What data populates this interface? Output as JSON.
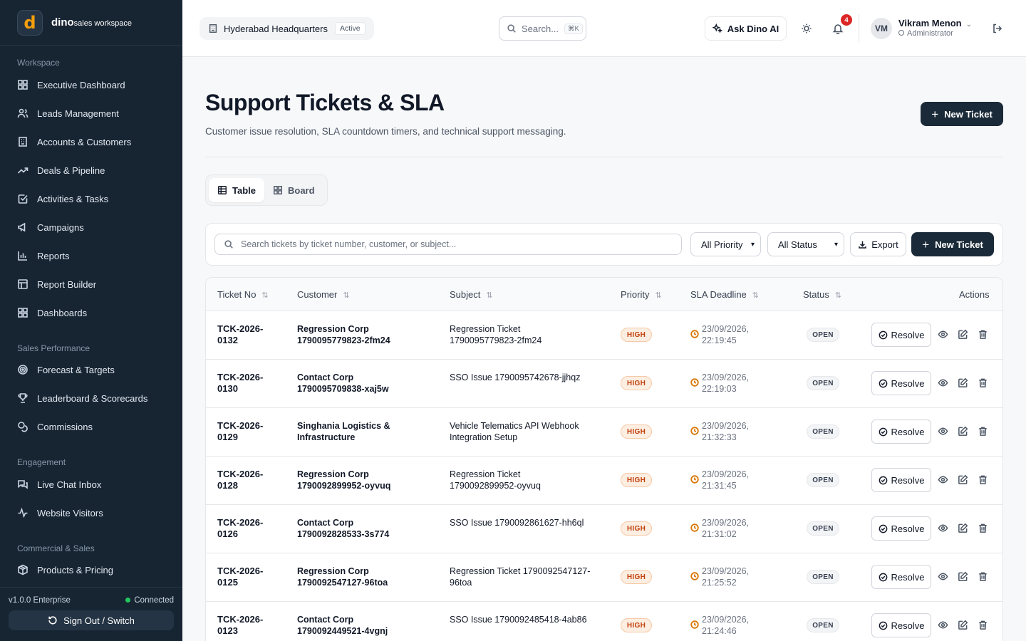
{
  "brand": {
    "logo_letter": "d",
    "name": "dino",
    "subtitle": "sales workspace"
  },
  "sidebar": {
    "sections": [
      {
        "title": "Workspace",
        "items": [
          {
            "label": "Executive Dashboard",
            "icon": "grid-icon"
          },
          {
            "label": "Leads Management",
            "icon": "users-icon"
          },
          {
            "label": "Accounts & Customers",
            "icon": "building-icon"
          },
          {
            "label": "Deals & Pipeline",
            "icon": "trend-icon"
          },
          {
            "label": "Activities & Tasks",
            "icon": "check-square-icon"
          },
          {
            "label": "Campaigns",
            "icon": "megaphone-icon"
          },
          {
            "label": "Reports",
            "icon": "bar-chart-icon"
          },
          {
            "label": "Report Builder",
            "icon": "table-icon"
          },
          {
            "label": "Dashboards",
            "icon": "grid-icon"
          }
        ]
      },
      {
        "title": "Sales Performance",
        "items": [
          {
            "label": "Forecast & Targets",
            "icon": "target-icon"
          },
          {
            "label": "Leaderboard & Scorecards",
            "icon": "trophy-icon"
          },
          {
            "label": "Commissions",
            "icon": "coins-icon"
          }
        ]
      },
      {
        "title": "Engagement",
        "items": [
          {
            "label": "Live Chat Inbox",
            "icon": "chat-icon"
          },
          {
            "label": "Website Visitors",
            "icon": "activity-icon"
          }
        ]
      },
      {
        "title": "Commercial & Sales",
        "items": [
          {
            "label": "Products & Pricing",
            "icon": "package-icon"
          }
        ]
      }
    ],
    "footer": {
      "version": "v1.0.0 Enterprise",
      "connection": "Connected",
      "signout_label": "Sign Out / Switch"
    }
  },
  "topbar": {
    "org_name": "Hyderabad Headquarters",
    "org_status": "Active",
    "search_placeholder": "Search...",
    "search_shortcut": "⌘K",
    "ask_ai_label": "Ask Dino AI",
    "notification_count": "4",
    "user": {
      "initials": "VM",
      "name": "Vikram Menon",
      "role": "Administrator"
    }
  },
  "page": {
    "title": "Support Tickets & SLA",
    "subtitle": "Customer issue resolution, SLA countdown timers, and technical support messaging.",
    "new_ticket_label": "New Ticket",
    "view_tabs": [
      {
        "label": "Table",
        "active": true
      },
      {
        "label": "Board",
        "active": false
      }
    ]
  },
  "filters": {
    "search_placeholder": "Search tickets by ticket number, customer, or subject...",
    "priority_selected": "All Priority",
    "status_selected": "All Status",
    "export_label": "Export",
    "new_ticket_label": "New Ticket"
  },
  "table": {
    "columns": {
      "ticket_no": "Ticket No",
      "customer": "Customer",
      "subject": "Subject",
      "priority": "Priority",
      "sla": "SLA Deadline",
      "status": "Status",
      "actions": "Actions"
    },
    "resolve_label": "Resolve",
    "rows": [
      {
        "ticket_a": "TCK-2026-",
        "ticket_b": "0132",
        "customer_a": "Regression Corp",
        "customer_b": "1790095779823-2fm24",
        "subject_a": "Regression Ticket",
        "subject_b": "1790095779823-2fm24",
        "priority": "HIGH",
        "sla_date": "23/09/2026,",
        "sla_time": "22:19:45",
        "status": "OPEN"
      },
      {
        "ticket_a": "TCK-2026-",
        "ticket_b": "0130",
        "customer_a": "Contact Corp",
        "customer_b": "1790095709838-xaj5w",
        "subject_a": "SSO Issue 1790095742678-jjhqz",
        "subject_b": "",
        "priority": "HIGH",
        "sla_date": "23/09/2026,",
        "sla_time": "22:19:03",
        "status": "OPEN"
      },
      {
        "ticket_a": "TCK-2026-",
        "ticket_b": "0129",
        "customer_a": "Singhania Logistics &",
        "customer_b": "Infrastructure",
        "subject_a": "Vehicle Telematics API Webhook",
        "subject_b": "Integration Setup",
        "priority": "HIGH",
        "sla_date": "23/09/2026,",
        "sla_time": "21:32:33",
        "status": "OPEN"
      },
      {
        "ticket_a": "TCK-2026-",
        "ticket_b": "0128",
        "customer_a": "Regression Corp",
        "customer_b": "1790092899952-oyvuq",
        "subject_a": "Regression Ticket",
        "subject_b": "1790092899952-oyvuq",
        "priority": "HIGH",
        "sla_date": "23/09/2026,",
        "sla_time": "21:31:45",
        "status": "OPEN"
      },
      {
        "ticket_a": "TCK-2026-",
        "ticket_b": "0126",
        "customer_a": "Contact Corp",
        "customer_b": "1790092828533-3s774",
        "subject_a": "SSO Issue 1790092861627-hh6ql",
        "subject_b": "",
        "priority": "HIGH",
        "sla_date": "23/09/2026,",
        "sla_time": "21:31:02",
        "status": "OPEN"
      },
      {
        "ticket_a": "TCK-2026-",
        "ticket_b": "0125",
        "customer_a": "Regression Corp",
        "customer_b": "1790092547127-96toa",
        "subject_a": "Regression Ticket 1790092547127-",
        "subject_b": "96toa",
        "priority": "HIGH",
        "sla_date": "23/09/2026,",
        "sla_time": "21:25:52",
        "status": "OPEN"
      },
      {
        "ticket_a": "TCK-2026-",
        "ticket_b": "0123",
        "customer_a": "Contact Corp",
        "customer_b": "1790092449521-4vgnj",
        "subject_a": "SSO Issue 1790092485418-4ab86",
        "subject_b": "",
        "priority": "HIGH",
        "sla_date": "23/09/2026,",
        "sla_time": "21:24:46",
        "status": "OPEN"
      }
    ]
  },
  "colors": {
    "sidebar_bg": "#172533",
    "primary": "#1b2a38",
    "high_badge": "#c2410c",
    "sla_clock": "#d97706",
    "connected": "#22c55e",
    "notification": "#dc2626"
  }
}
